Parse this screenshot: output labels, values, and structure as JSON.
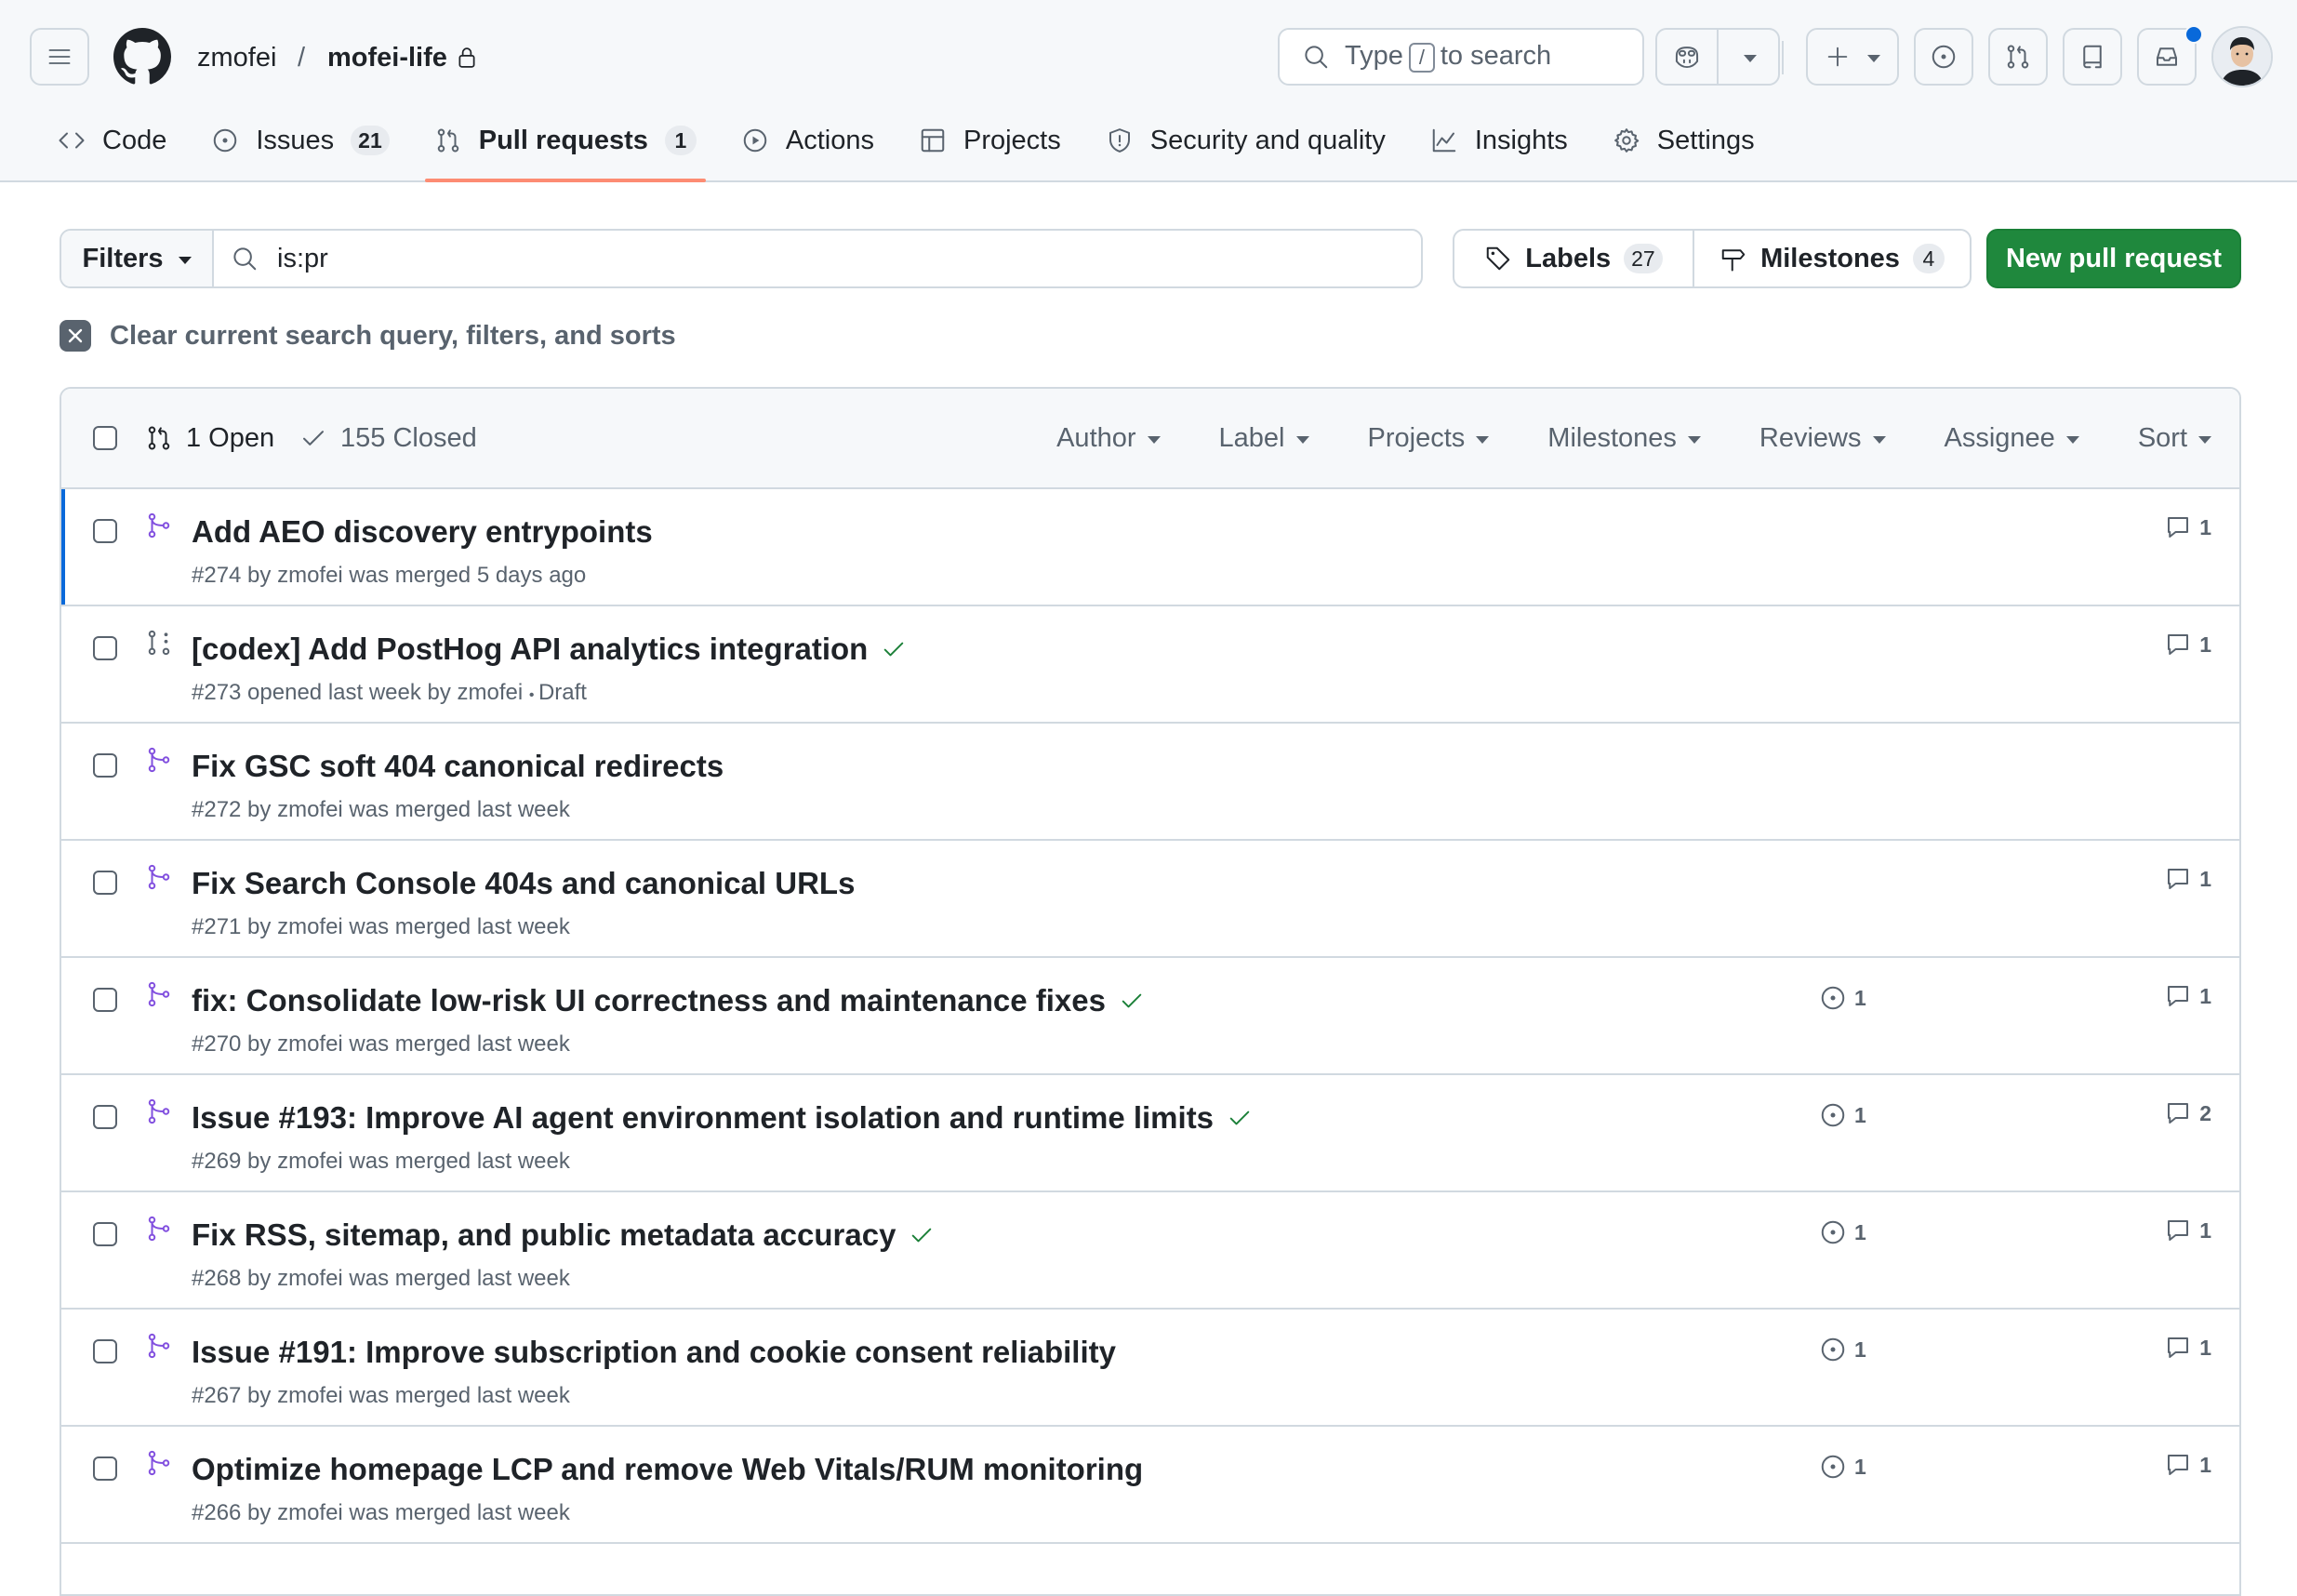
{
  "header": {
    "owner": "zmofei",
    "separator": "/",
    "repo": "mofei-life",
    "search": {
      "prefix": "Type",
      "key": "/",
      "suffix": "to search"
    }
  },
  "tabs": [
    {
      "label": "Code",
      "icon": "code-icon"
    },
    {
      "label": "Issues",
      "icon": "issue-opened-icon",
      "count": "21"
    },
    {
      "label": "Pull requests",
      "icon": "git-pull-request-icon",
      "count": "1",
      "active": true
    },
    {
      "label": "Actions",
      "icon": "play-icon"
    },
    {
      "label": "Projects",
      "icon": "table-icon"
    },
    {
      "label": "Security and quality",
      "icon": "shield-icon"
    },
    {
      "label": "Insights",
      "icon": "graph-icon"
    },
    {
      "label": "Settings",
      "icon": "gear-icon"
    }
  ],
  "toolbar": {
    "filters_label": "Filters",
    "query": "is:pr",
    "labels_label": "Labels",
    "labels_count": "27",
    "milestones_label": "Milestones",
    "milestones_count": "4",
    "new_pr_label": "New pull request",
    "clear_label": "Clear current search query, filters, and sorts"
  },
  "list": {
    "open_label": "1 Open",
    "closed_label": "155 Closed",
    "sort_options": [
      "Author",
      "Label",
      "Projects",
      "Milestones",
      "Reviews",
      "Assignee",
      "Sort"
    ],
    "rows": [
      {
        "title": "Add AEO discovery entrypoints",
        "meta": "#274 by zmofei was merged 5 days ago",
        "state": "merged",
        "check": false,
        "linked": "",
        "comments": "1",
        "selected": true
      },
      {
        "title": "[codex] Add PostHog API analytics integration",
        "meta": "#273 opened last week by zmofei",
        "draft": "Draft",
        "state": "draft",
        "check": true,
        "linked": "",
        "comments": "1"
      },
      {
        "title": "Fix GSC soft 404 canonical redirects",
        "meta": "#272 by zmofei was merged last week",
        "state": "merged",
        "check": false,
        "linked": "",
        "comments": ""
      },
      {
        "title": "Fix Search Console 404s and canonical URLs",
        "meta": "#271 by zmofei was merged last week",
        "state": "merged",
        "check": false,
        "linked": "",
        "comments": "1"
      },
      {
        "title": "fix: Consolidate low-risk UI correctness and maintenance fixes",
        "meta": "#270 by zmofei was merged last week",
        "state": "merged",
        "check": true,
        "linked": "1",
        "comments": "1"
      },
      {
        "title": "Issue #193: Improve AI agent environment isolation and runtime limits",
        "meta": "#269 by zmofei was merged last week",
        "state": "merged",
        "check": true,
        "linked": "1",
        "comments": "2"
      },
      {
        "title": "Fix RSS, sitemap, and public metadata accuracy",
        "meta": "#268 by zmofei was merged last week",
        "state": "merged",
        "check": true,
        "linked": "1",
        "comments": "1"
      },
      {
        "title": "Issue #191: Improve subscription and cookie consent reliability",
        "meta": "#267 by zmofei was merged last week",
        "state": "merged",
        "check": false,
        "linked": "1",
        "comments": "1"
      },
      {
        "title": "Optimize homepage LCP and remove Web Vitals/RUM monitoring",
        "meta": "#266 by zmofei was merged last week",
        "state": "merged",
        "check": false,
        "linked": "1",
        "comments": "1"
      }
    ]
  },
  "colors": {
    "merged": "#8250df",
    "check": "#1a7f37",
    "accent": "#0969da",
    "primary_button": "#1f883d",
    "tab_underline": "#fd8c73"
  }
}
